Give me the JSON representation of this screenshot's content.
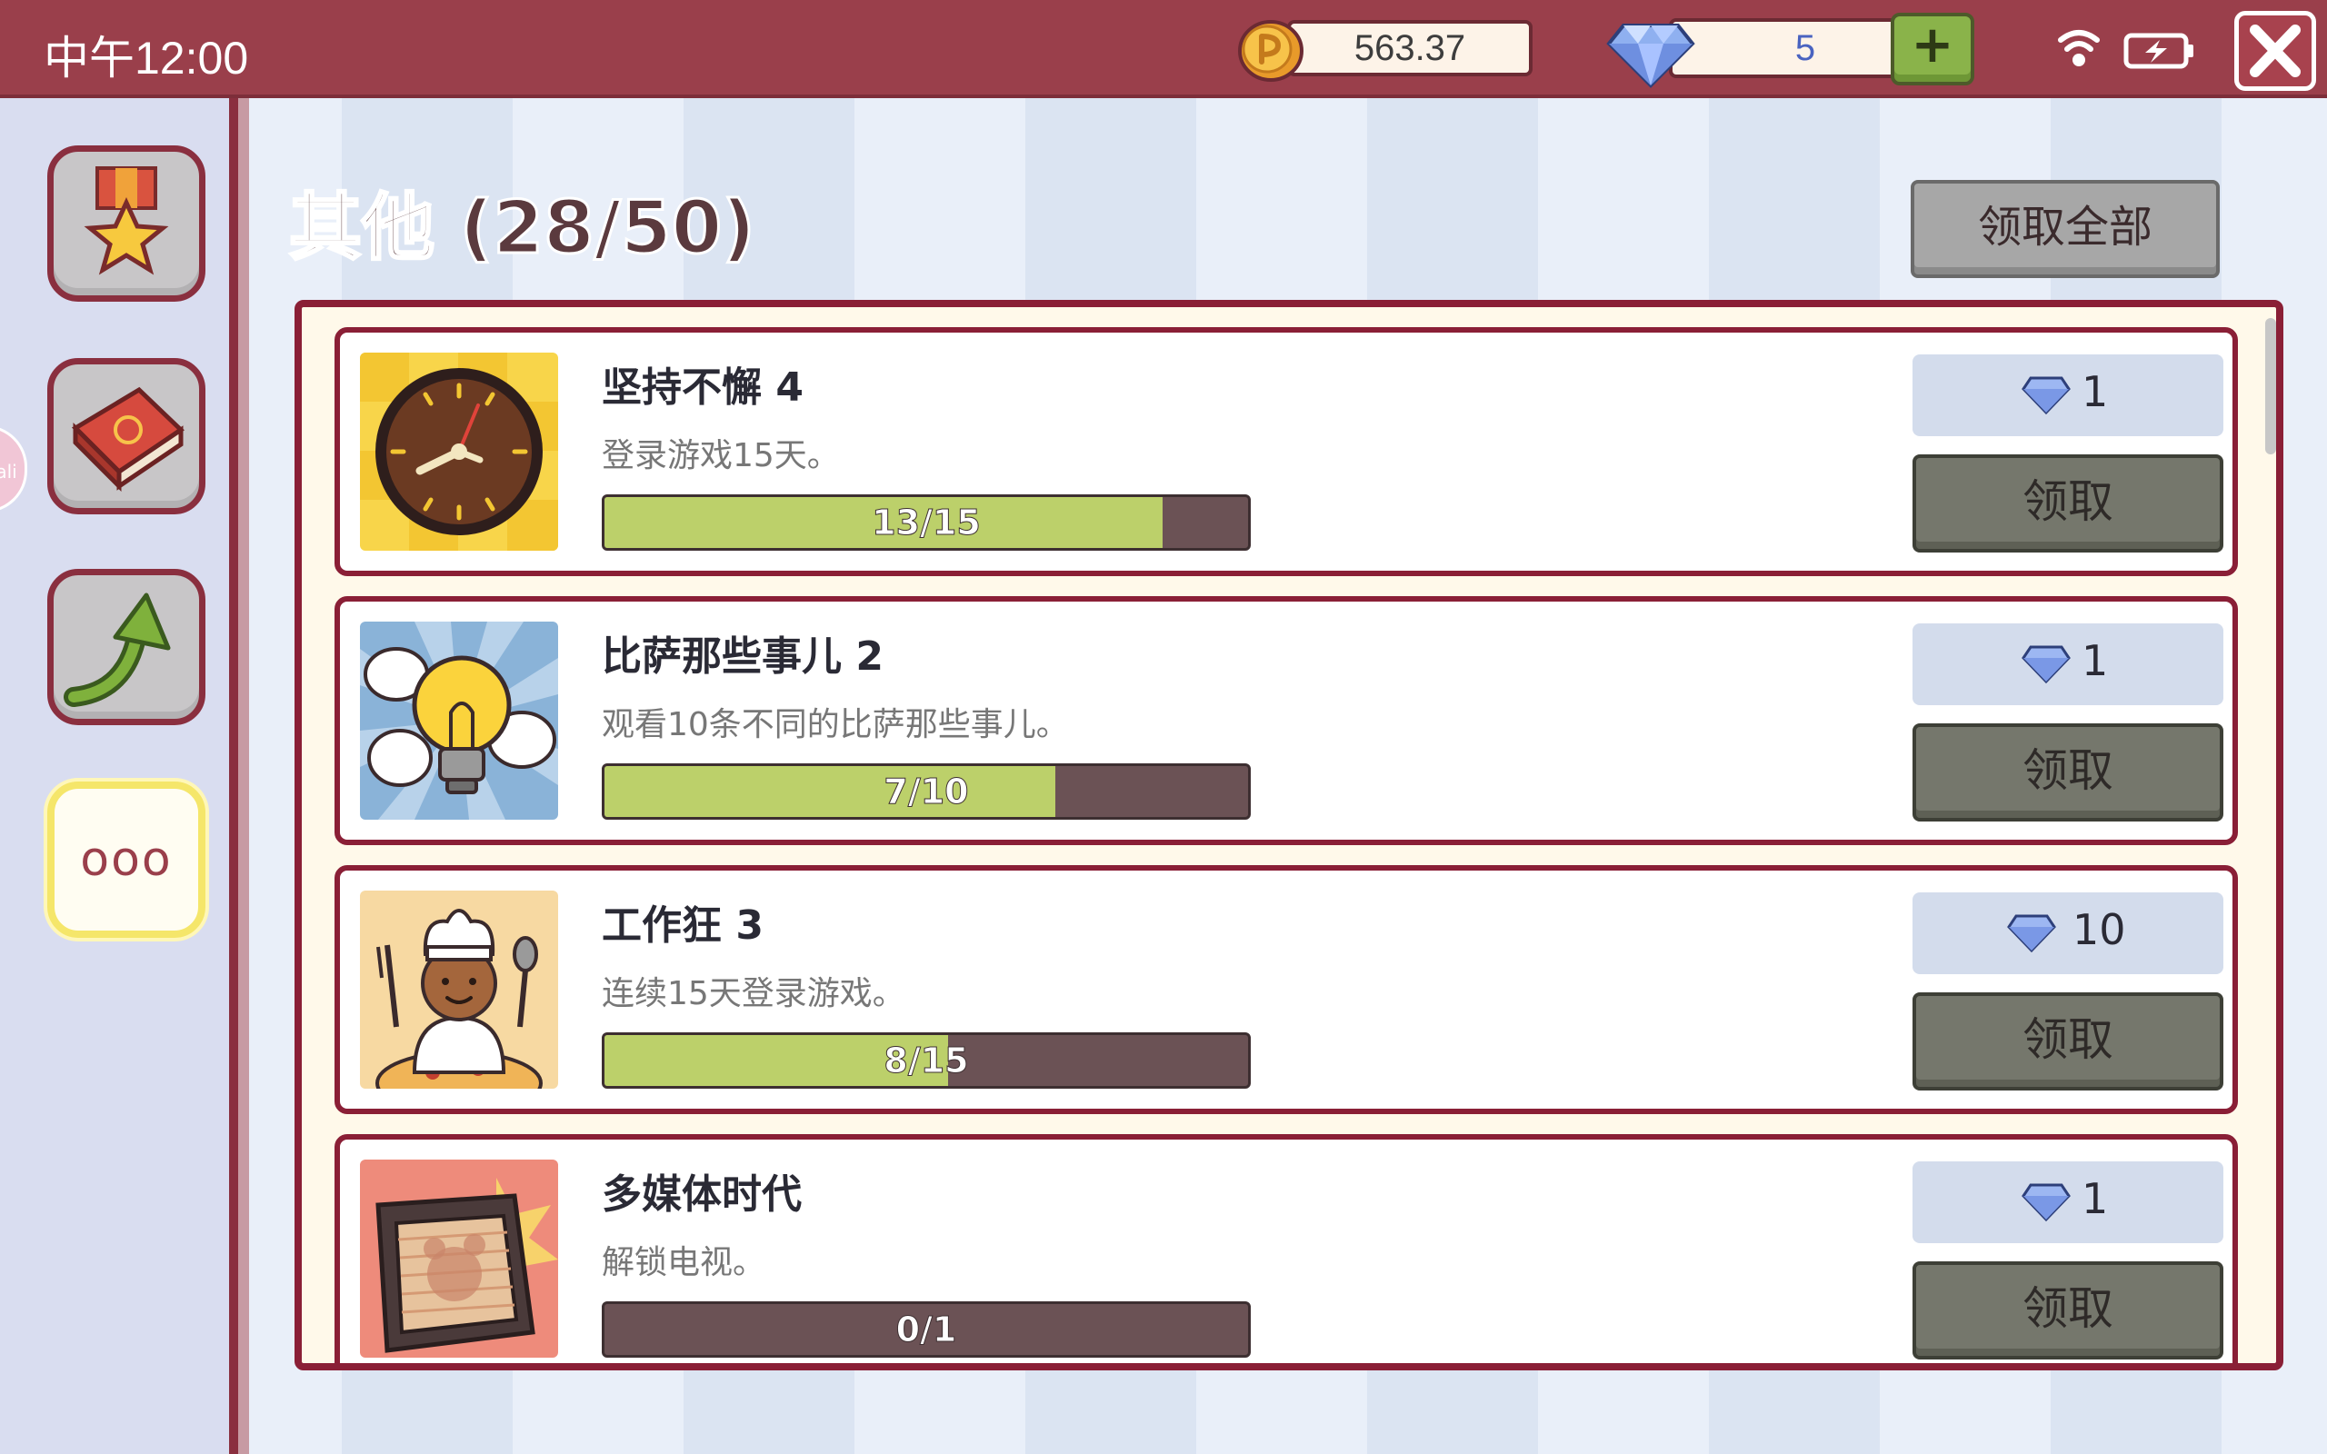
{
  "status_bar": {
    "time": "中午12:00"
  },
  "currency": {
    "coins": "563.37",
    "gems": "5",
    "add_label": "+"
  },
  "sidebar": {
    "items": [
      {
        "name": "achievements",
        "icon": "medal-star-icon"
      },
      {
        "name": "book",
        "icon": "book-icon"
      },
      {
        "name": "upgrade",
        "icon": "arrow-up-icon"
      },
      {
        "name": "other",
        "icon": "more-icon",
        "label": "ooo",
        "active": true
      }
    ]
  },
  "header": {
    "title": "其他 (28/50)",
    "claim_all_label": "领取全部"
  },
  "tasks": [
    {
      "title": "坚持不懈  4",
      "description": "登录游戏15天。",
      "progress": 13,
      "total": 15,
      "progress_label": "13/15",
      "reward": "1",
      "claim_label": "领取",
      "icon": "clock-icon"
    },
    {
      "title": "比萨那些事儿  2",
      "description": "观看10条不同的比萨那些事儿。",
      "progress": 7,
      "total": 10,
      "progress_label": "7/10",
      "reward": "1",
      "claim_label": "领取",
      "icon": "lightbulb-icon"
    },
    {
      "title": "工作狂  3",
      "description": "连续15天登录游戏。",
      "progress": 8,
      "total": 15,
      "progress_label": "8/15",
      "reward": "10",
      "claim_label": "领取",
      "icon": "chef-icon"
    },
    {
      "title": "多媒体时代",
      "description": "解锁电视。",
      "progress": 0,
      "total": 1,
      "progress_label": "0/1",
      "reward": "1",
      "claim_label": "领取",
      "icon": "tv-icon"
    }
  ],
  "colors": {
    "topbar": "#9a3f4b",
    "border": "#8a1f36",
    "progress_fill": "#bcd06a",
    "progress_track": "#6b5255"
  }
}
